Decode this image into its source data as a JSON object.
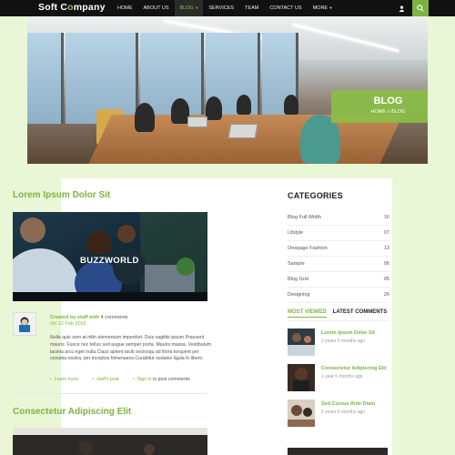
{
  "brand": {
    "part1": "S",
    "part2": "oft C",
    "part3": "o",
    "part4": "mpany"
  },
  "nav": {
    "items": [
      {
        "label": "HOME",
        "active": false,
        "dropdown": false
      },
      {
        "label": "ABOUT US",
        "active": false,
        "dropdown": false
      },
      {
        "label": "BLOG",
        "active": true,
        "dropdown": true
      },
      {
        "label": "SERVICES",
        "active": false,
        "dropdown": false
      },
      {
        "label": "TEAM",
        "active": false,
        "dropdown": false
      },
      {
        "label": "CONTACT US",
        "active": false,
        "dropdown": false
      },
      {
        "label": "MORE",
        "active": false,
        "dropdown": true
      }
    ],
    "user_icon": "user-icon",
    "search_icon": "search-icon"
  },
  "hero": {
    "title": "BLOG",
    "crumb_home": "HOME",
    "crumb_sep": " » ",
    "crumb_current": "BLOG"
  },
  "post1": {
    "title": "Lorem Ipsum Dolor Sit",
    "image_caption_a": "BUZZ",
    "image_caption_b": "WORLD",
    "meta_prefix": "Created by ",
    "meta_author": "staff with",
    "meta_comments": "4 comments",
    "date": "On 12 Feb 2016",
    "excerpt": "Nulla quis sem at nibh elementum imperdiet. Duis sagittis ipsum Praesent mauris. Fusce nec tellus sed augue semper porta. Mauris massa. Vestibulum lacinia arcu eget nulla.Class aptent taciti sociosqu ad litora torquent per conubia nostra, per inceptos himenaeos.Curabitur sodales ligula in libero.",
    "learn_more": "Learn more",
    "staffs_post": "staff's post",
    "sign_in": "Sign in",
    "to_post": " to post comments"
  },
  "post2": {
    "title": "Consectetur Adipiscing Elit"
  },
  "sidebar": {
    "categories_title": "CATEGORIES",
    "categories": [
      {
        "name": "Blog Full Width",
        "count": "16"
      },
      {
        "name": "Lifstyle",
        "count": "07"
      },
      {
        "name": "Onepage Fashion",
        "count": "13"
      },
      {
        "name": "Sample",
        "count": "06"
      },
      {
        "name": "Blog Grid",
        "count": "05"
      },
      {
        "name": "Designing",
        "count": "26"
      }
    ],
    "tab_most": "MOST VIEWED",
    "tab_latest": "LATEST COMMENTS",
    "posts": [
      {
        "title": "Lorem Ipsum Dolor Sit",
        "time": "2 years 5 months ago"
      },
      {
        "title": "Consectetur Adipiscing Elit",
        "time": "1 year 6 months ago"
      },
      {
        "title": "Sed Cursus Ante Diam",
        "time": "2 years 5 months ago"
      }
    ]
  },
  "colors": {
    "accent": "#7cb342",
    "nav_bg": "#111111",
    "page_bg": "#e9f7d6"
  }
}
